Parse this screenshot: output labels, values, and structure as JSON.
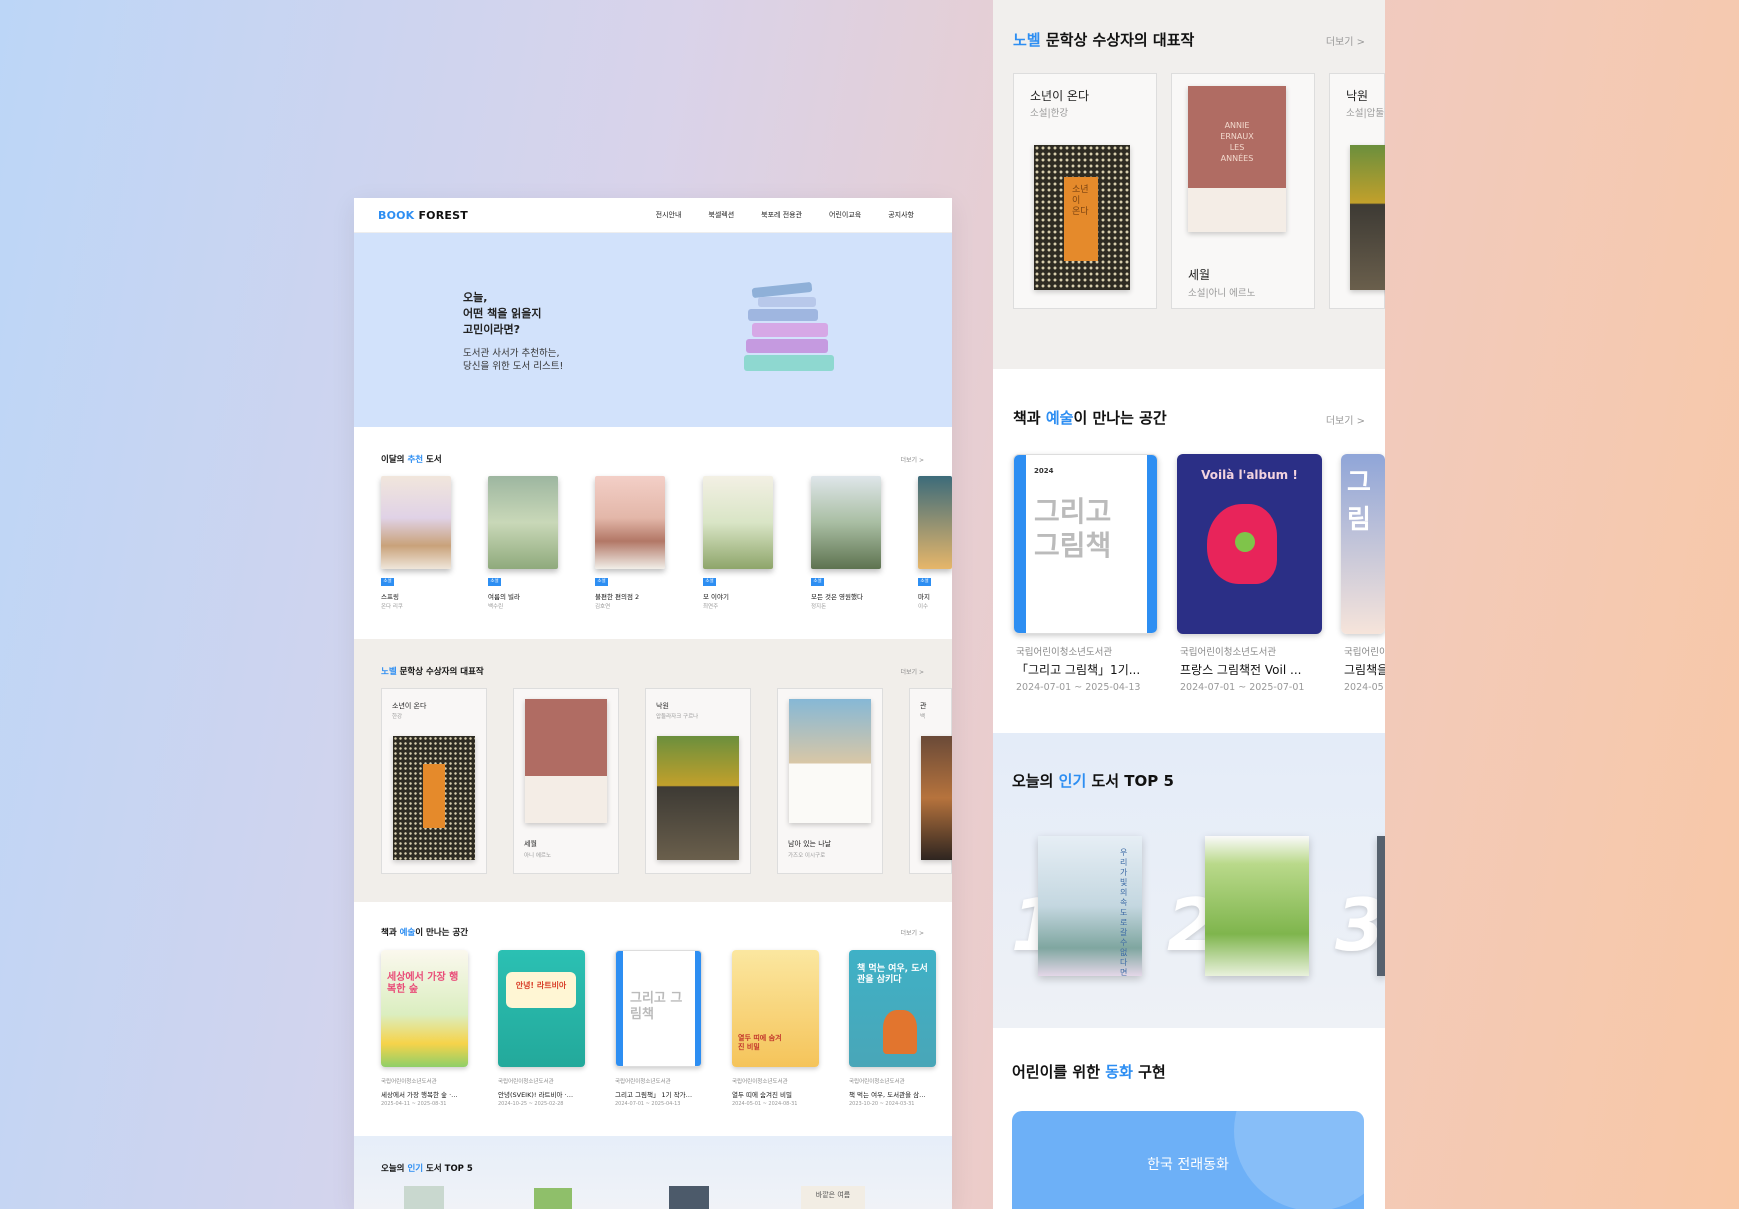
{
  "desktop": {
    "logo": {
      "part1": "BOOK",
      "part2": "FOREST"
    },
    "nav": [
      "전시안내",
      "북셀렉션",
      "북포레 전용관",
      "어린이교육",
      "공지사항"
    ],
    "hero": {
      "title_lines": [
        "오늘,",
        "어떤 책을 읽을지",
        "고민이라면?"
      ],
      "sub_lines": [
        "도서관 사서가 추천하는,",
        "당신을 위한 도서 리스트!"
      ]
    },
    "recommend": {
      "title_pre": "이달의",
      "title_hl": "추천",
      "title_post": "도서",
      "more": "더보기 >",
      "books": [
        {
          "tag": "소설",
          "title": "스프링",
          "author": "온다 리쿠"
        },
        {
          "tag": "소설",
          "title": "여름의 빌라",
          "author": "백수린"
        },
        {
          "tag": "소설",
          "title": "불편한 편의점 2",
          "author": "김호연"
        },
        {
          "tag": "소설",
          "title": "모 이야기",
          "author": "최연주"
        },
        {
          "tag": "소설",
          "title": "모든 것은 영원했다",
          "author": "정지돈"
        },
        {
          "tag": "소설",
          "title": "마지",
          "author": "이수"
        }
      ]
    },
    "nobel": {
      "title_hl": "노벨",
      "title_post": "문학상 수상자의 대표작",
      "more": "더보기 >",
      "cards": [
        {
          "title": "소년이 온다",
          "sub": "한강"
        },
        {
          "title": "세월",
          "sub": "아니 에르노"
        },
        {
          "title": "낙원",
          "sub": "압둘라자크 구르나"
        },
        {
          "title": "남아 있는 나날",
          "sub": "가즈오 이시구로"
        },
        {
          "title": "관",
          "sub": "백"
        }
      ]
    },
    "art": {
      "title_pre": "책과",
      "title_hl": "예술",
      "title_post": "이 만나는 공간",
      "more": "더보기 >",
      "items": [
        {
          "org": "국립어린이청소년도서관",
          "title": "세상에서 가장 행복한 숲 ·…",
          "date": "2025-04-11 ~ 2025-08-31",
          "poster": "세상에서 가장 행복한 숲"
        },
        {
          "org": "국립어린이청소년도서관",
          "title": "안녕(SVEIK)! 라트비아 ·…",
          "date": "2024-10-25 ~ 2025-02-28",
          "poster": "안녕! 라트비아"
        },
        {
          "org": "국립어린이청소년도서관",
          "title": "그리고 그림책」 1기 작가…",
          "date": "2024-07-01 ~ 2025-04-13",
          "poster": "그리고 그림책"
        },
        {
          "org": "국립어린이청소년도서관",
          "title": "열두 띠에 숨겨진 비밀",
          "date": "2024-05-01 ~ 2024-08-31",
          "poster": "열두 띠에 숨겨진 비밀"
        },
        {
          "org": "국립어린이청소년도서관",
          "title": "책 먹는 여우, 도서관을 삼…",
          "date": "2023-10-20 ~ 2024-03-31",
          "poster": "책 먹는 여우, 도서관을 삼키다"
        }
      ]
    },
    "top5": {
      "title_pre": "오늘의",
      "title_hl": "인기",
      "title_post": "도서 TOP 5",
      "cover_text": "바깥은 여름"
    }
  },
  "mobile": {
    "nobel": {
      "title_hl": "노벨",
      "title_post": "문학상 수상자의 대표작",
      "more": "더보기 >",
      "cards": [
        {
          "title": "소년이 온다",
          "sub": "소설|한강"
        },
        {
          "title": "세월",
          "sub": "소설|아니 에르노"
        },
        {
          "title": "낙원",
          "sub": "소설|압둘라자"
        }
      ],
      "cover1_text": "소년이 온다",
      "cover2_text": [
        "ANNIE",
        "ERNAUX",
        "LES",
        "ANNÉES"
      ]
    },
    "art": {
      "title_pre": "책과",
      "title_hl": "예술",
      "title_post": "이 만나는 공간",
      "more": "더보기 >",
      "items": [
        {
          "org": "국립어린이청소년도서관",
          "title": "「그리고 그림책」1기...",
          "date": "2024-07-01 ~ 2025-04-13",
          "poster_year": "2024",
          "poster_text": "그리고 그림책"
        },
        {
          "org": "국립어린이청소년도서관",
          "title": "프랑스 그림책전 Voil ...",
          "date": "2024-07-01 ~ 2025-07-01",
          "poster_text": "Voilà l'album !"
        },
        {
          "org": "국립어린이",
          "title": "그림책을",
          "date": "2024-05",
          "poster_text": "그림"
        }
      ]
    },
    "top5": {
      "title_pre": "오늘의",
      "title_hl": "인기",
      "title_post": "도서 TOP 5",
      "ranks": [
        "1",
        "2",
        "3"
      ],
      "cover1_text": "우리가 빛의 속도로 갈 수 없다면"
    },
    "fairy": {
      "title_pre": "어린이를 위한",
      "title_hl": "동화",
      "title_post": "구현",
      "button": "한국 전래동화"
    }
  },
  "colors": {
    "accent": "#2d8ef2",
    "hero_bg": "#d2e2fb",
    "fairy_bg": "#6db0f7"
  }
}
